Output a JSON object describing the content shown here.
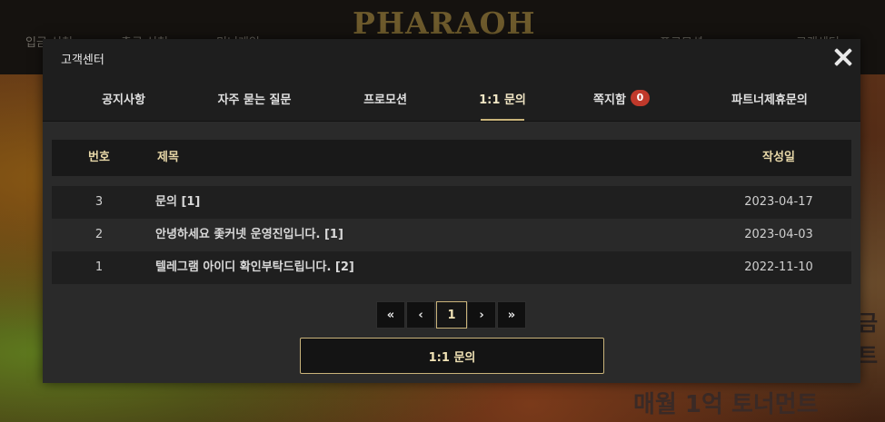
{
  "background": {
    "nav_left": [
      "입금 신청",
      "출금 신청",
      "미니게임"
    ],
    "nav_right": [
      "프로모션",
      "고객센터"
    ],
    "logo": "PHARAOH",
    "promo_bottom": "매월 1억 토너먼트",
    "promo_side": [
      "금",
      "트"
    ]
  },
  "modal": {
    "title": "고객센터",
    "close_icon": "close-icon",
    "tabs": [
      {
        "label": "공지사항"
      },
      {
        "label": "자주 묻는 질문"
      },
      {
        "label": "프로모션"
      },
      {
        "label": "1:1 문의",
        "active": true
      },
      {
        "label": "쪽지함",
        "badge": "0"
      },
      {
        "label": "파트너제휴문의"
      }
    ],
    "table": {
      "headers": {
        "number": "번호",
        "subject": "제목",
        "date": "작성일"
      },
      "rows": [
        {
          "number": "3",
          "subject": "문의 [1]",
          "date": "2023-04-17"
        },
        {
          "number": "2",
          "subject": "안녕하세요 좇커넷 운영진입니다. [1]",
          "date": "2023-04-03"
        },
        {
          "number": "1",
          "subject": "텔레그램 아이디 확인부탁드립니다. [2]",
          "date": "2022-11-10"
        }
      ]
    },
    "pagination": {
      "first": "«",
      "prev": "‹",
      "current": "1",
      "next": "›",
      "last": "»"
    },
    "inquiry_button": "1:1 문의"
  },
  "colors": {
    "accent_gold": "#c9b37a",
    "badge_red": "#c0392b",
    "modal_bg": "#2a2a2a"
  }
}
